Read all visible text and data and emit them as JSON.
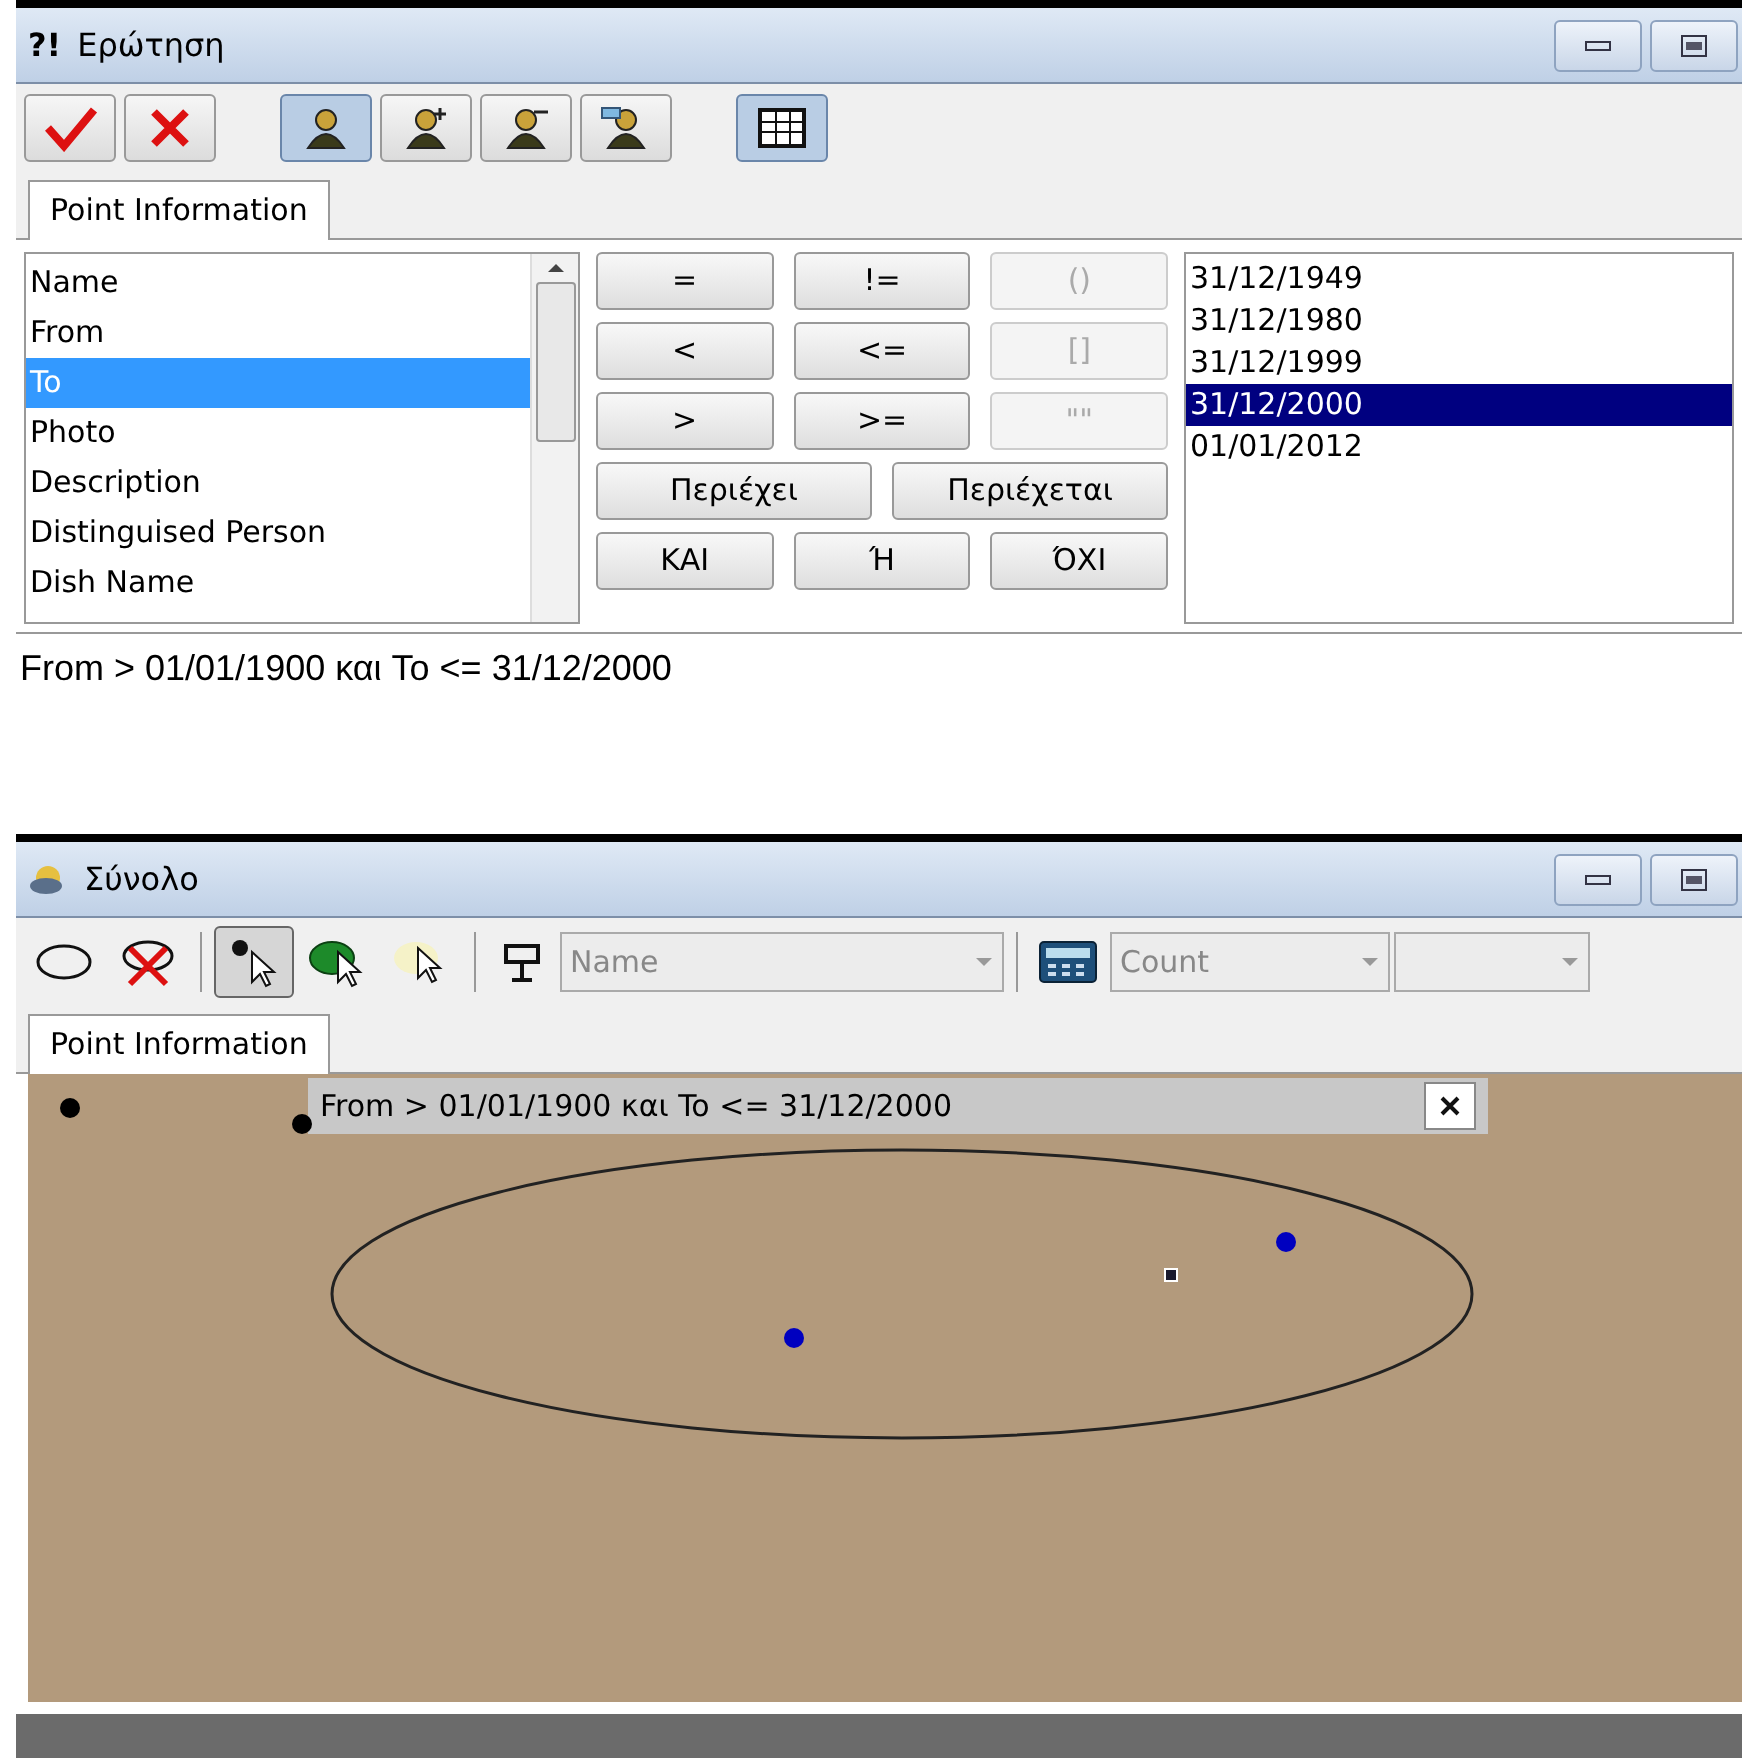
{
  "query_window": {
    "title_icon": "?!",
    "title": "Ερώτηση",
    "toolbar": [
      {
        "kind": "confirm",
        "selected": false
      },
      {
        "kind": "cancel",
        "selected": false
      },
      {
        "kind": "gap"
      },
      {
        "kind": "figure",
        "selected": true
      },
      {
        "kind": "figure-plus",
        "selected": false
      },
      {
        "kind": "figure-minus",
        "selected": false
      },
      {
        "kind": "figure-link",
        "selected": false
      },
      {
        "kind": "gap"
      },
      {
        "kind": "table",
        "selected": true
      }
    ],
    "tabs": [
      {
        "label": "Point Information",
        "selected": true
      }
    ],
    "fields": [
      {
        "label": "Name",
        "selected": false
      },
      {
        "label": "From",
        "selected": false
      },
      {
        "label": "To",
        "selected": true
      },
      {
        "label": "Photo",
        "selected": false
      },
      {
        "label": "Description",
        "selected": false
      },
      {
        "label": "Distinguised Person",
        "selected": false
      },
      {
        "label": "Dish Name",
        "selected": false
      }
    ],
    "operator_rows": [
      [
        {
          "label": "=",
          "disabled": false
        },
        {
          "label": "!=",
          "disabled": false
        },
        {
          "label": "()",
          "disabled": true
        }
      ],
      [
        {
          "label": "<",
          "disabled": false
        },
        {
          "label": "<=",
          "disabled": false
        },
        {
          "label": "[]",
          "disabled": true
        }
      ],
      [
        {
          "label": ">",
          "disabled": false
        },
        {
          "label": ">=",
          "disabled": false
        },
        {
          "label": "\"\"",
          "disabled": true
        }
      ],
      [
        {
          "label": "Περιέχει",
          "disabled": false
        },
        {
          "label": "Περιέχεται",
          "disabled": false
        }
      ],
      [
        {
          "label": "ΚΑΙ",
          "disabled": false
        },
        {
          "label": "Ή",
          "disabled": false
        },
        {
          "label": "ΌΧΙ",
          "disabled": false
        }
      ]
    ],
    "values": [
      {
        "label": "31/12/1949",
        "selected": false
      },
      {
        "label": "31/12/1980",
        "selected": false
      },
      {
        "label": "31/12/1999",
        "selected": false
      },
      {
        "label": "31/12/2000",
        "selected": true
      },
      {
        "label": "01/01/2012",
        "selected": false
      }
    ]
  },
  "expression": "From > 01/01/1900 και To <= 31/12/2000",
  "result_window": {
    "title": "Σύνολο",
    "toolbar": [
      {
        "kind": "ellipse",
        "selected": false
      },
      {
        "kind": "clear",
        "selected": false
      },
      {
        "kind": "separator"
      },
      {
        "kind": "pick",
        "selected": true
      },
      {
        "kind": "pick-green",
        "selected": false
      },
      {
        "kind": "pick-yellow",
        "selected": false
      },
      {
        "kind": "separator"
      },
      {
        "kind": "sign"
      },
      {
        "kind": "dropdown",
        "value": "Name",
        "disabled": true
      },
      {
        "kind": "separator"
      },
      {
        "kind": "calculator"
      },
      {
        "kind": "dropdown",
        "value": "Count",
        "disabled": true
      },
      {
        "kind": "dropdown",
        "disabled": true
      }
    ],
    "tabs": [
      {
        "label": "Point Information",
        "selected": true
      }
    ],
    "map_label": "From > 01/01/1900 και To <= 31/12/2000",
    "points": [
      {
        "kind": "dot",
        "color": "#000000"
      },
      {
        "kind": "dot",
        "color": "#000000"
      },
      {
        "kind": "dot",
        "color": "#0000c0"
      },
      {
        "kind": "square",
        "color": "#1a1a2e"
      },
      {
        "kind": "dot",
        "color": "#0000c0"
      }
    ]
  }
}
